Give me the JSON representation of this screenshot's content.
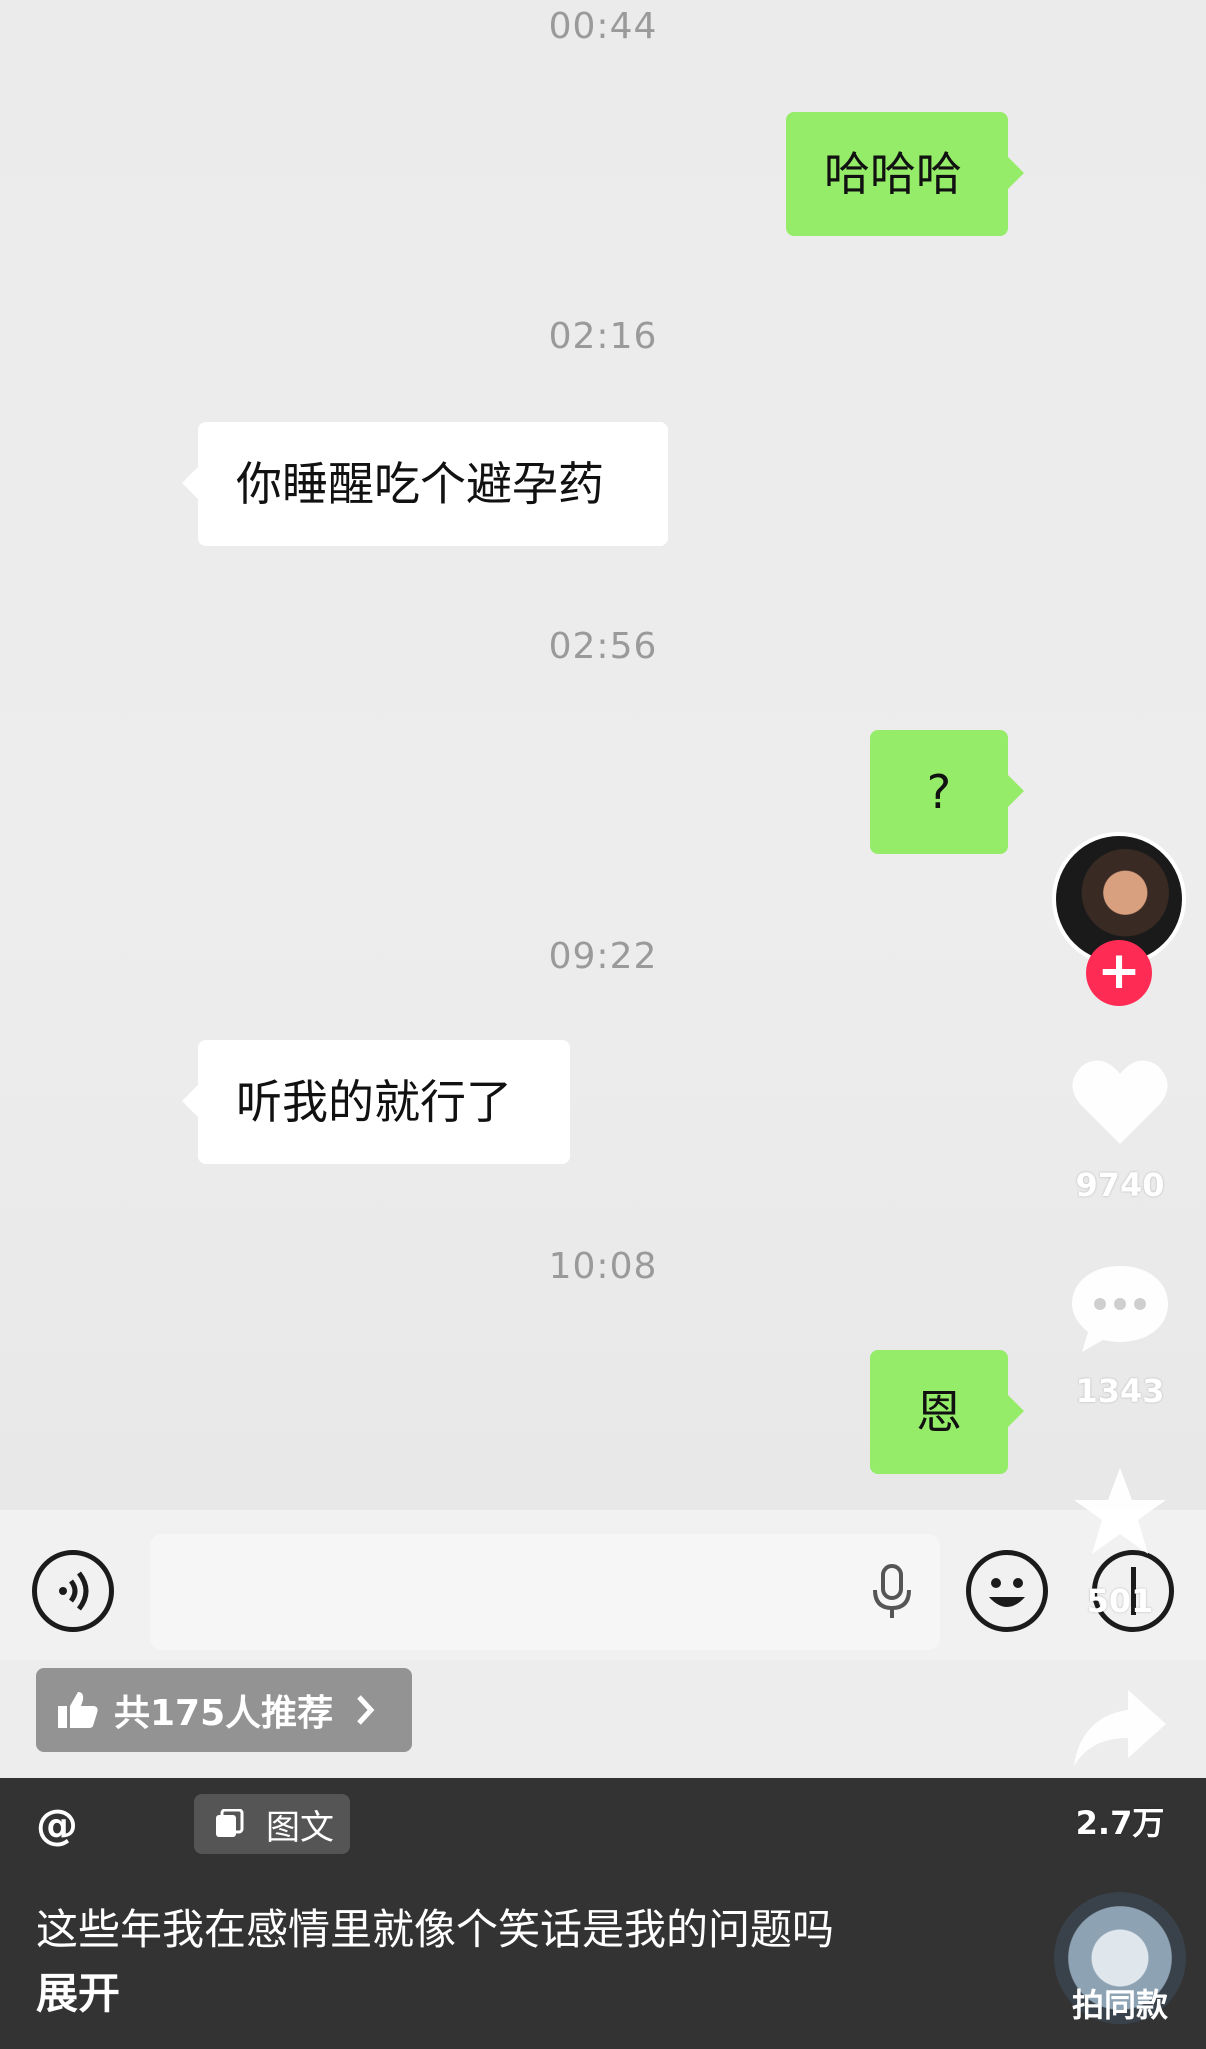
{
  "chat": {
    "timestamps": [
      "00:44",
      "02:16",
      "02:56",
      "09:22",
      "10:08"
    ],
    "messages": [
      {
        "side": "right",
        "text": "哈哈哈"
      },
      {
        "side": "left",
        "text": "你睡醒吃个避孕药"
      },
      {
        "side": "right",
        "text": "?"
      },
      {
        "side": "left",
        "text": "听我的就行了"
      },
      {
        "side": "right",
        "text": "恩"
      }
    ]
  },
  "recommend": {
    "label": "共175人推荐"
  },
  "post": {
    "author_prefix": "@",
    "type_tag": "图文",
    "caption": "这些年我在感情里就像个笑话是我的问题吗",
    "expand_label": "展开"
  },
  "rail": {
    "likes": "9740",
    "comments": "1343",
    "favorites": "501",
    "shares": "2.7万",
    "same_style": "拍同款"
  },
  "icons": {
    "like": "heart-icon",
    "comment": "comment-bubble-icon",
    "favorite": "star-icon",
    "share": "share-arrow-icon",
    "follow": "plus-icon",
    "voice": "voice-icon",
    "mic": "microphone-icon",
    "emoji": "smiley-icon",
    "more": "plus-circle-icon",
    "recommend": "thumbs-up-icon",
    "tag": "document-icon"
  },
  "colors": {
    "sent_bubble": "#95ec69",
    "received_bubble": "#ffffff",
    "follow": "#fe2c55",
    "panel": "#333333"
  }
}
